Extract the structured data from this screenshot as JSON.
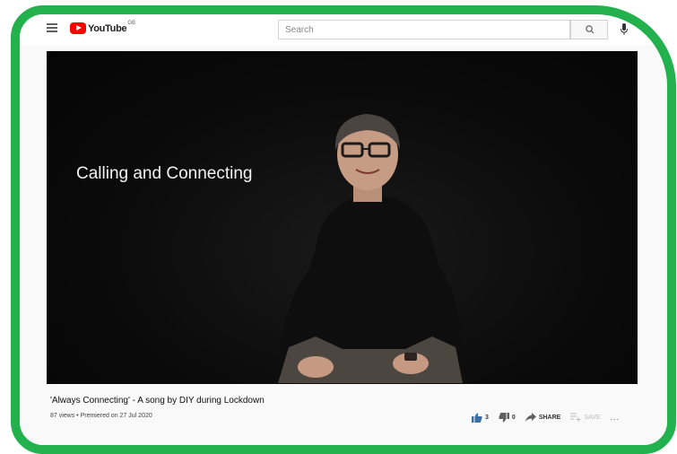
{
  "header": {
    "logo_text": "YouTube",
    "region": "GB",
    "search": {
      "placeholder": "Search",
      "value": ""
    }
  },
  "player": {
    "overlay_title": "Calling and Connecting"
  },
  "video": {
    "title": "'Always Connecting' - A song by DIY during Lockdown",
    "meta": "87 views • Premiered on 27 Jul 2020",
    "likes": "3",
    "dislikes": "0",
    "share_label": "SHARE",
    "save_label": "SAVE",
    "more_label": "..."
  },
  "colors": {
    "frame": "#22b14c",
    "brand": "#ff0000",
    "like_active": "#3b6ea5"
  },
  "icons": [
    "menu-icon",
    "youtube-logo-icon",
    "search-icon",
    "mic-icon",
    "thumbs-up-icon",
    "thumbs-down-icon",
    "share-icon",
    "save-playlist-icon"
  ]
}
